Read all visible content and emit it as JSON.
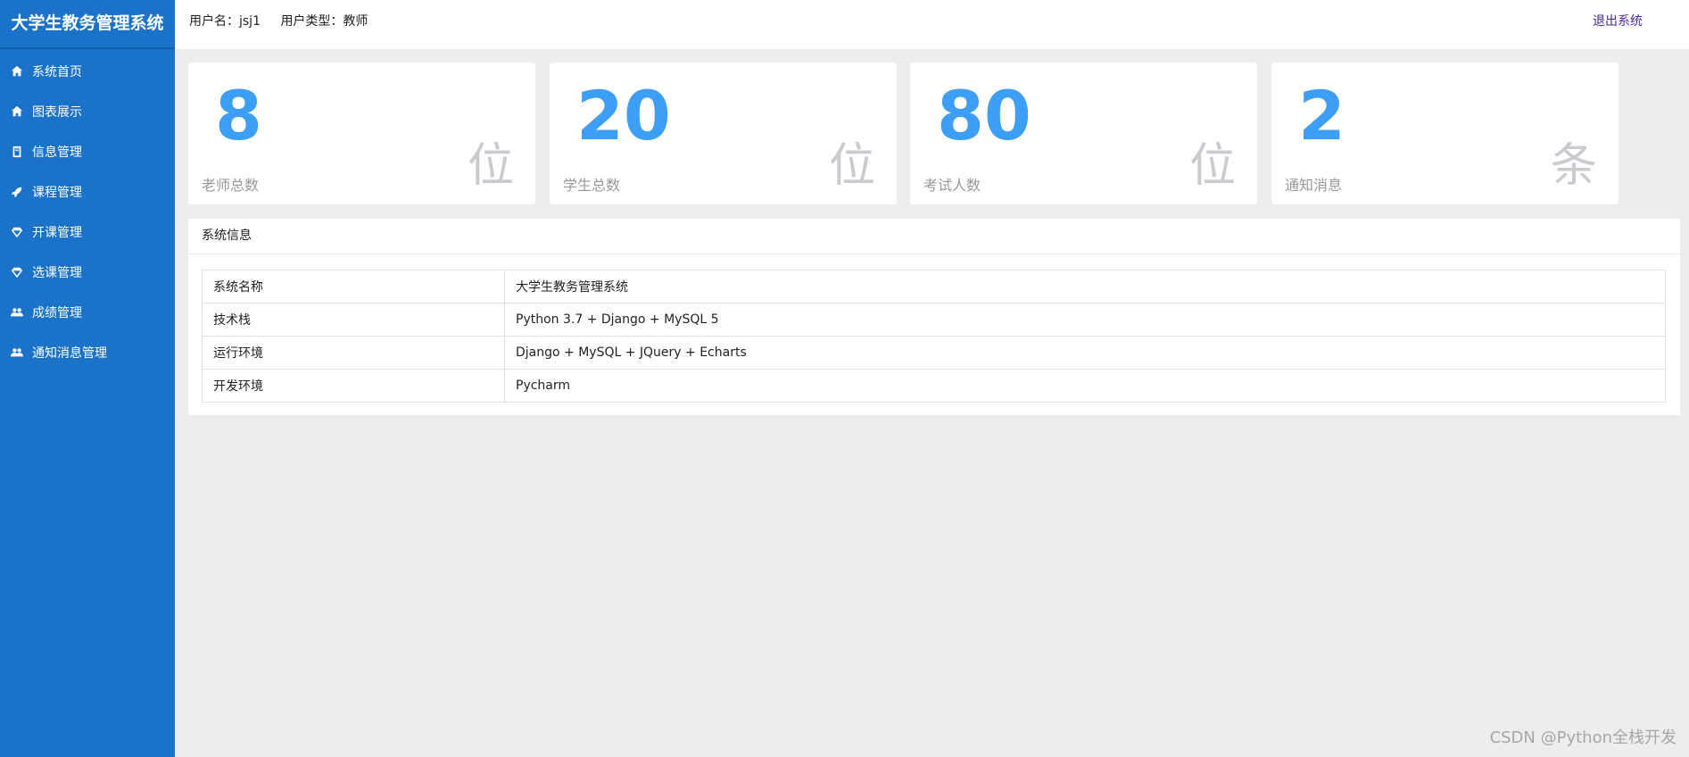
{
  "app": {
    "title": "大学生教务管理系统"
  },
  "sidebar": {
    "items": [
      {
        "label": "系统首页",
        "icon": "home-icon"
      },
      {
        "label": "图表展示",
        "icon": "home-icon"
      },
      {
        "label": "信息管理",
        "icon": "book-icon"
      },
      {
        "label": "课程管理",
        "icon": "rocket-icon"
      },
      {
        "label": "开课管理",
        "icon": "diamond-icon"
      },
      {
        "label": "选课管理",
        "icon": "diamond-icon"
      },
      {
        "label": "成绩管理",
        "icon": "users-icon"
      },
      {
        "label": "通知消息管理",
        "icon": "users-icon"
      }
    ]
  },
  "header": {
    "username_label": "用户名：",
    "username": "jsj1",
    "usertype_label": "用户类型：",
    "usertype": "教师",
    "logout_label": "退出系统"
  },
  "stats": [
    {
      "value": "8",
      "label": "老师总数",
      "unit": "位"
    },
    {
      "value": "20",
      "label": "学生总数",
      "unit": "位"
    },
    {
      "value": "80",
      "label": "考试人数",
      "unit": "位"
    },
    {
      "value": "2",
      "label": "通知消息",
      "unit": "条"
    }
  ],
  "system_info": {
    "title": "系统信息",
    "rows": [
      {
        "key": "系统名称",
        "value": "大学生教务管理系统"
      },
      {
        "key": "技术栈",
        "value": "Python 3.7 + Django + MySQL 5"
      },
      {
        "key": "运行环境",
        "value": "Django + MySQL + JQuery + Echarts"
      },
      {
        "key": "开发环境",
        "value": "Pycharm"
      }
    ]
  },
  "watermark": "CSDN @Python全栈开发",
  "colors": {
    "sidebar": "#1a73c9",
    "accent_number": "#3d9ef5",
    "background": "#ededed",
    "logout_link": "#4a2aa0"
  }
}
